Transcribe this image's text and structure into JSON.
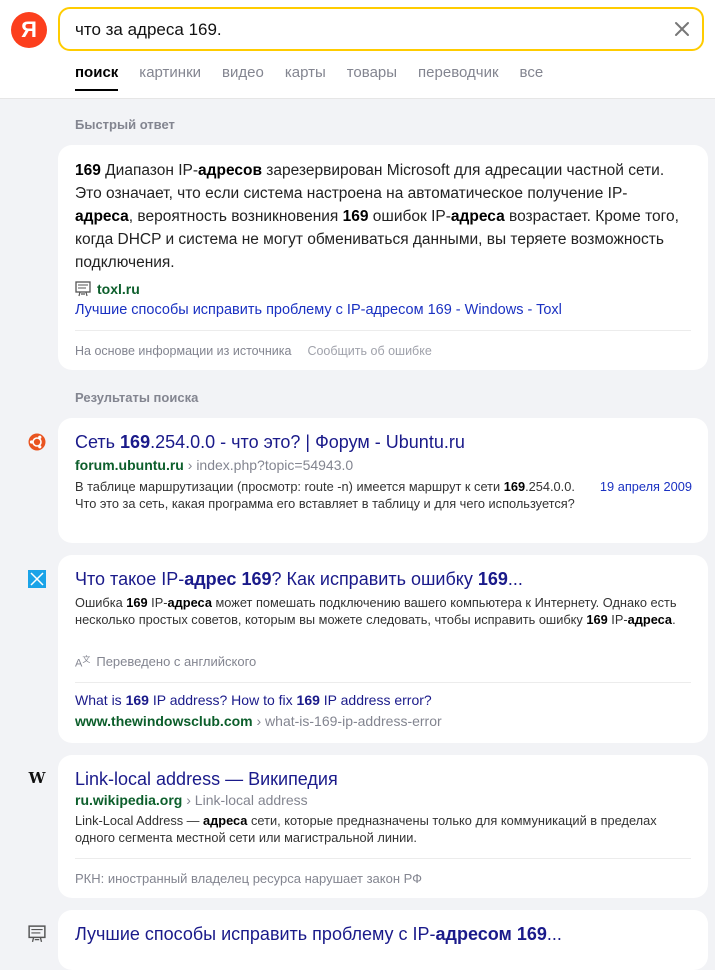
{
  "header": {
    "logo_letter": "Я",
    "search_value": "что за адреса 169.",
    "tabs": [
      "поиск",
      "картинки",
      "видео",
      "карты",
      "товары",
      "переводчик",
      "все"
    ]
  },
  "quick_answer": {
    "section_title": "Быстрый ответ",
    "text_parts": [
      {
        "t": "169",
        "b": true
      },
      {
        "t": " Диапазон IP-",
        "b": false
      },
      {
        "t": "адресов",
        "b": true
      },
      {
        "t": " зарезервирован Microsoft для адресации частной сети. Это означает, что если система настроена на автоматическое получение IP-",
        "b": false
      },
      {
        "t": "адреса",
        "b": true
      },
      {
        "t": ", вероятность возникновения ",
        "b": false
      },
      {
        "t": "169",
        "b": true
      },
      {
        "t": " ошибок IP-",
        "b": false
      },
      {
        "t": "адреса",
        "b": true
      },
      {
        "t": " возрастает. Кроме того, когда DHCP и система не могут обмениваться данными, вы теряете возможность подключения.",
        "b": false
      }
    ],
    "source_name": "toxl.ru",
    "link_text": "Лучшие способы исправить проблему с IP-адресом 169 - Windows - Toxl",
    "footer_based_on": "На основе информации из источника",
    "footer_report": "Сообщить об ошибке"
  },
  "results_title": "Результаты поиска",
  "results": [
    {
      "icon": "ubuntu-icon",
      "title_parts": [
        {
          "t": "Сеть ",
          "b": false
        },
        {
          "t": "169",
          "b": true
        },
        {
          "t": ".254.0.0 - что это? | Форум - Ubuntu.ru",
          "b": false
        }
      ],
      "host": "forum.ubuntu.ru",
      "path": " › index.php?topic=54943.0",
      "date": "19 апреля 2009",
      "snippet_parts": [
        {
          "t": "В таблице маршрутизации (просмотр: route -n) имеется маршрут к сети ",
          "b": false
        },
        {
          "t": "169",
          "b": true
        },
        {
          "t": ".254.0.0. Что это за сеть, какая программа его вставляет в таблицу и для чего используется?",
          "b": false
        }
      ]
    },
    {
      "icon": "windows-icon",
      "title_parts": [
        {
          "t": "Что такое IP-",
          "b": false
        },
        {
          "t": "адрес",
          "b": true
        },
        {
          "t": " ",
          "b": false
        },
        {
          "t": "169",
          "b": true
        },
        {
          "t": "? Как исправить ошибку ",
          "b": false
        },
        {
          "t": "169",
          "b": true
        },
        {
          "t": "...",
          "b": false
        }
      ],
      "snippet_parts": [
        {
          "t": "Ошибка ",
          "b": false
        },
        {
          "t": "169",
          "b": true
        },
        {
          "t": " IP-",
          "b": false
        },
        {
          "t": "адреса",
          "b": true
        },
        {
          "t": " может помешать подключению вашего компьютера к Интернету. Однако есть несколько простых советов, которым вы можете следовать, чтобы исправить ошибку ",
          "b": false
        },
        {
          "t": "169",
          "b": true
        },
        {
          "t": " IP-",
          "b": false
        },
        {
          "t": "адреса",
          "b": true
        },
        {
          "t": ".",
          "b": false
        }
      ],
      "translated": "Переведено с английского",
      "orig_title_parts": [
        {
          "t": "What is ",
          "b": false
        },
        {
          "t": "169",
          "b": true
        },
        {
          "t": " IP address? How to fix ",
          "b": false
        },
        {
          "t": "169",
          "b": true
        },
        {
          "t": " IP address error?",
          "b": false
        }
      ],
      "host": "www.thewindowsclub.com",
      "path": " › what-is-169-ip-address-error"
    },
    {
      "icon": "wikipedia-icon",
      "title_parts": [
        {
          "t": "Link-local address — Википедия",
          "b": false
        }
      ],
      "host": "ru.wikipedia.org",
      "path": " › Link-local address",
      "snippet_parts": [
        {
          "t": "Link-Local Address — ",
          "b": false
        },
        {
          "t": "адреса",
          "b": true
        },
        {
          "t": " сети, которые предназначены только для коммуникаций в пределах одного сегмента местной сети или магистральной линии.",
          "b": false
        }
      ],
      "rkn": "РКН: иностранный владелец ресурса нарушает закон РФ"
    },
    {
      "icon": "toxl-icon",
      "title_parts": [
        {
          "t": "Лучшие способы исправить проблему с IP-",
          "b": false
        },
        {
          "t": "адресом",
          "b": true
        },
        {
          "t": " ",
          "b": false
        },
        {
          "t": "169",
          "b": true
        },
        {
          "t": "...",
          "b": false
        }
      ]
    }
  ]
}
